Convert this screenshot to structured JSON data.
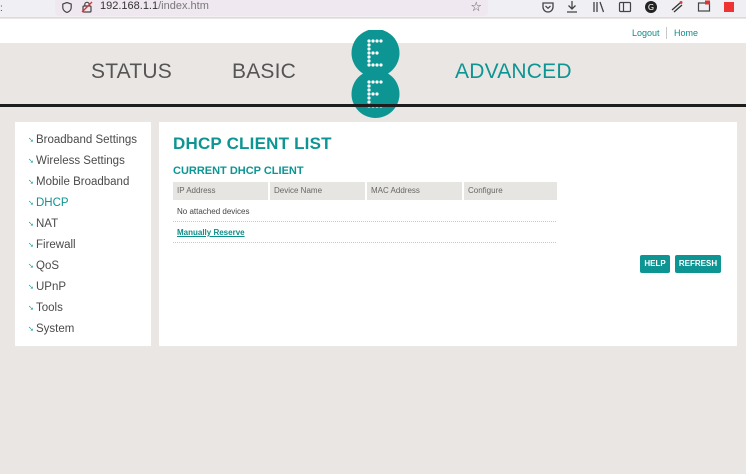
{
  "browser": {
    "url_host": "192.168.1.1",
    "url_path": "/index.htm",
    "icons": [
      "shield-icon",
      "lock-icon",
      "bookmark-star-icon",
      "pocket-icon",
      "download-icon",
      "library-icon",
      "sidebar-icon",
      "profile-icon",
      "extension-icon",
      "screenshot-icon",
      "menu-icon"
    ]
  },
  "header": {
    "logout": "Logout",
    "home": "Home",
    "nav": {
      "status": "STATUS",
      "basic": "BASIC",
      "advanced": "ADVANCED"
    },
    "logo_letter_top": "E",
    "logo_letter_bottom": "E"
  },
  "sidebar": {
    "items": [
      {
        "label": "Broadband Settings"
      },
      {
        "label": "Wireless Settings"
      },
      {
        "label": "Mobile Broadband"
      },
      {
        "label": "DHCP"
      },
      {
        "label": "NAT"
      },
      {
        "label": "Firewall"
      },
      {
        "label": "QoS"
      },
      {
        "label": "UPnP"
      },
      {
        "label": "Tools"
      },
      {
        "label": "System"
      }
    ],
    "active": "DHCP"
  },
  "main": {
    "title": "DHCP CLIENT LIST",
    "section_title": "CURRENT DHCP CLIENT",
    "columns": [
      "IP Address",
      "Device Name",
      "MAC Address",
      "Configure"
    ],
    "empty_message": "No attached devices",
    "manual_reserve": "Manually Reserve",
    "help_button": "HELP",
    "refresh_button": "REFRESH"
  },
  "colors": {
    "accent": "#0d9593",
    "background": "#e9e6e3",
    "nav_inactive": "#555555"
  }
}
